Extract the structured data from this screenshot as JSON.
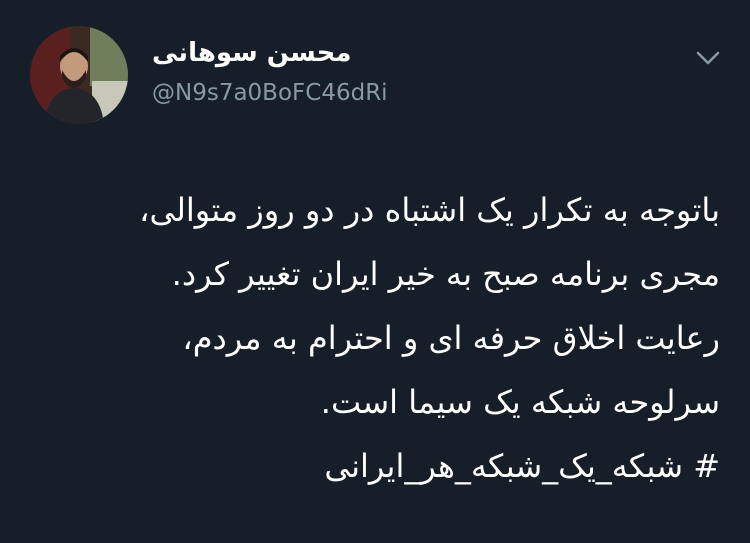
{
  "author": {
    "display_name": "محسن سوهانی",
    "handle": "@N9s7a0BoFC46dRi",
    "avatar_icon": "user-avatar-photo"
  },
  "menu": {
    "icon": "chevron-down-icon"
  },
  "tweet": {
    "lines": [
      "باتوجه به تکرار یک اشتباه در دو روز متوالی،",
      "مجری برنامه صبح به خیر ایران تغییر کرد.",
      "رعایت اخلاق حرفه ای و احترام به مردم،",
      "سرلوحه شبکه یک سیما است.",
      "# شبکه_یک_شبکه_هر_ایرانی"
    ]
  },
  "colors": {
    "background": "#161e2a",
    "text": "#ffffff",
    "secondary": "#8899a6"
  }
}
